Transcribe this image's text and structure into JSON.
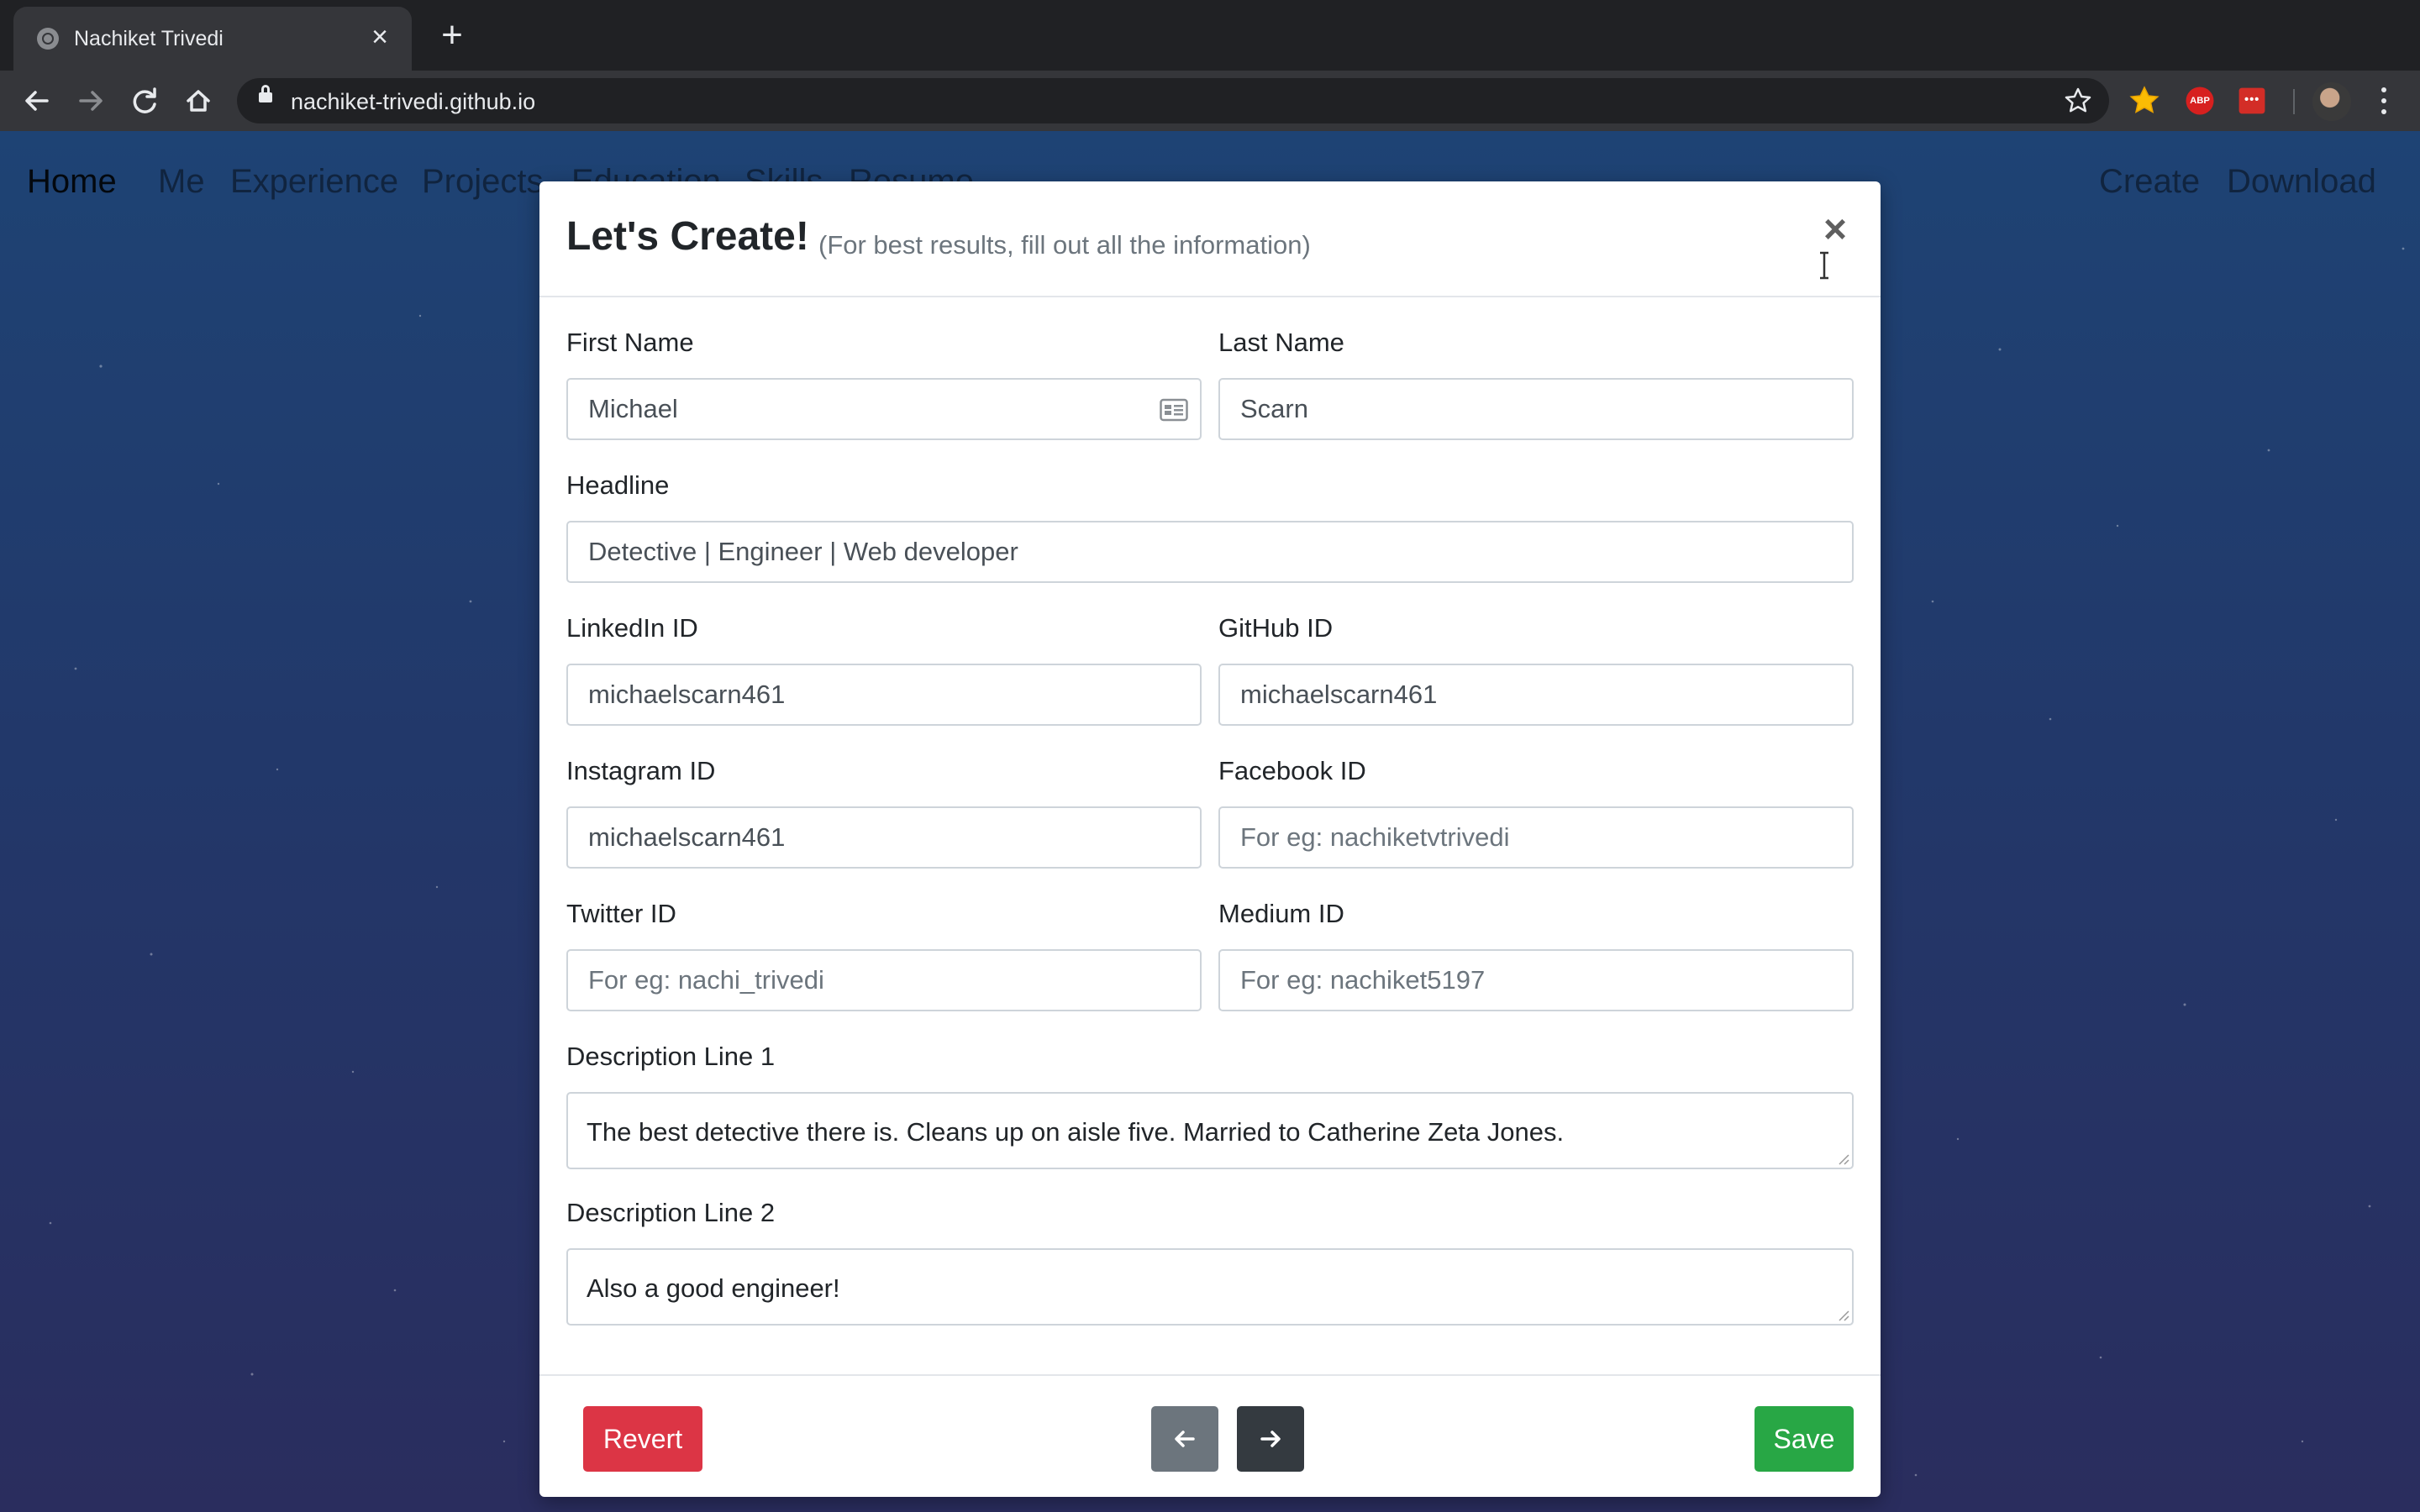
{
  "browser": {
    "tab_title": "Nachiket Trivedi",
    "url": "nachiket-trivedi.github.io",
    "extensions": {
      "abp_label": "ABP"
    }
  },
  "site_nav": {
    "brand": "Home",
    "items": [
      "Me",
      "Experience",
      "Projects",
      "Education",
      "Skills",
      "Resume"
    ],
    "right_items": [
      "Create",
      "Download"
    ]
  },
  "modal": {
    "title": "Let's Create!",
    "subtitle": "(For best results, fill out all the information)",
    "fields": {
      "first_name": {
        "label": "First Name",
        "value": "Michael",
        "placeholder": ""
      },
      "last_name": {
        "label": "Last Name",
        "value": "Scarn",
        "placeholder": ""
      },
      "headline": {
        "label": "Headline",
        "value": "Detective | Engineer | Web developer",
        "placeholder": ""
      },
      "linkedin": {
        "label": "LinkedIn ID",
        "value": "michaelscarn461",
        "placeholder": ""
      },
      "github": {
        "label": "GitHub ID",
        "value": "michaelscarn461",
        "placeholder": ""
      },
      "instagram": {
        "label": "Instagram ID",
        "value": "michaelscarn461",
        "placeholder": ""
      },
      "facebook": {
        "label": "Facebook ID",
        "value": "",
        "placeholder": "For eg: nachiketvtrivedi"
      },
      "twitter": {
        "label": "Twitter ID",
        "value": "",
        "placeholder": "For eg: nachi_trivedi"
      },
      "medium": {
        "label": "Medium ID",
        "value": "",
        "placeholder": "For eg: nachiket5197"
      },
      "description1": {
        "label": "Description Line 1",
        "value": "The best detective there is. Cleans up on aisle five. Married to Catherine Zeta Jones."
      },
      "description2": {
        "label": "Description Line 2",
        "value": "Also a good engineer!"
      }
    },
    "footer": {
      "revert_label": "Revert",
      "save_label": "Save",
      "prev_icon": "arrow-left-icon",
      "next_icon": "arrow-right-icon"
    }
  },
  "colors": {
    "danger": "#dc3545",
    "success": "#28a745",
    "secondary": "#6c757d",
    "dark": "#343a40"
  }
}
